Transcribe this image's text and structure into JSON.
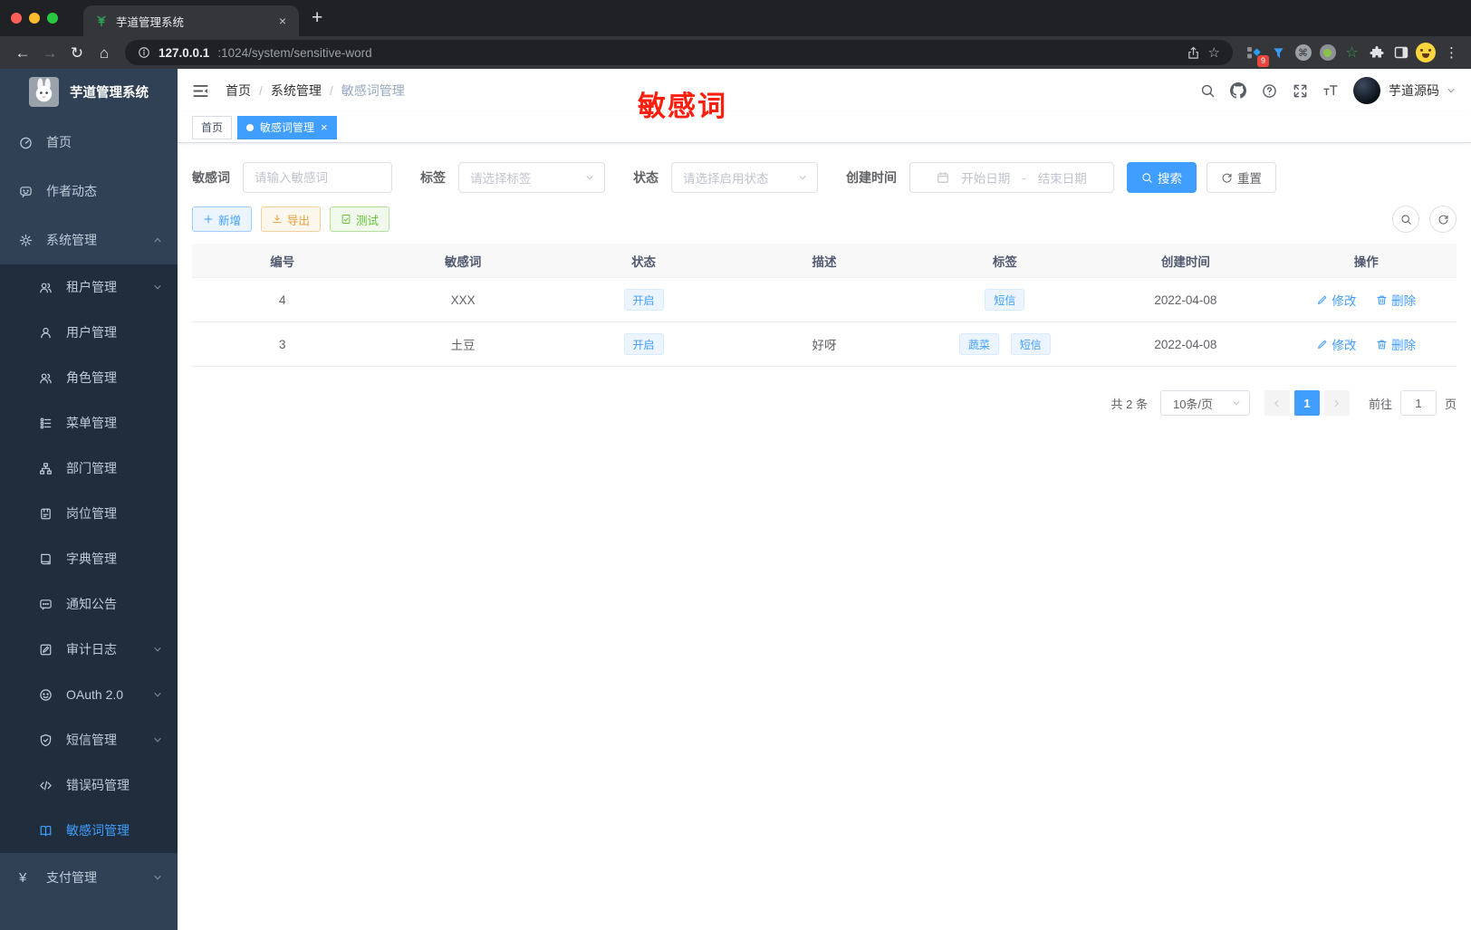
{
  "browser": {
    "tab_title": "芋道管理系统",
    "url_host": "127.0.0.1",
    "url_rest": ":1024/system/sensitive-word",
    "ext_badge": "9"
  },
  "icons": {
    "close": "×",
    "plus": "+",
    "kebab": "⋮",
    "star_outline": "☆",
    "back": "←",
    "forward": "→",
    "reload": "↻",
    "home": "⌂",
    "command": "⌘",
    "yen": "¥"
  },
  "sidebar": {
    "title": "芋道管理系统",
    "items": [
      {
        "label": "首页"
      },
      {
        "label": "作者动态"
      },
      {
        "label": "系统管理"
      },
      {
        "label": "租户管理"
      },
      {
        "label": "用户管理"
      },
      {
        "label": "角色管理"
      },
      {
        "label": "菜单管理"
      },
      {
        "label": "部门管理"
      },
      {
        "label": "岗位管理"
      },
      {
        "label": "字典管理"
      },
      {
        "label": "通知公告"
      },
      {
        "label": "审计日志"
      },
      {
        "label": "OAuth 2.0"
      },
      {
        "label": "短信管理"
      },
      {
        "label": "错误码管理"
      },
      {
        "label": "敏感词管理"
      },
      {
        "label": "支付管理"
      }
    ]
  },
  "navbar": {
    "breadcrumb": [
      {
        "label": "首页"
      },
      {
        "label": "系统管理"
      },
      {
        "label": "敏感词管理"
      }
    ],
    "sep": "/",
    "username": "芋道源码"
  },
  "tagsbar": {
    "tabs": [
      {
        "label": "首页"
      },
      {
        "label": "敏感词管理"
      }
    ]
  },
  "annotation": {
    "text": "敏感词",
    "color": "#ff1f0f"
  },
  "filters": {
    "keyword": {
      "label": "敏感词",
      "placeholder": "请输入敏感词"
    },
    "tag": {
      "label": "标签",
      "placeholder": "请选择标签"
    },
    "status": {
      "label": "状态",
      "placeholder": "请选择启用状态"
    },
    "created": {
      "label": "创建时间",
      "start_placeholder": "开始日期",
      "separator": "-",
      "end_placeholder": "结束日期"
    },
    "search_label": "搜索",
    "reset_label": "重置"
  },
  "toolbar": {
    "add": "新增",
    "export": "导出",
    "test": "测试"
  },
  "table": {
    "columns": [
      "编号",
      "敏感词",
      "状态",
      "描述",
      "标签",
      "创建时间",
      "操作"
    ],
    "actions": {
      "edit": "修改",
      "delete": "删除"
    },
    "rows": [
      {
        "id": "4",
        "word": "XXX",
        "status": "开启",
        "description": "",
        "tags": [
          "短信"
        ],
        "created": "2022-04-08"
      },
      {
        "id": "3",
        "word": "土豆",
        "status": "开启",
        "description": "好呀",
        "tags": [
          "蔬菜",
          "短信"
        ],
        "created": "2022-04-08"
      }
    ]
  },
  "pagination": {
    "total": "共 2 条",
    "page_size": "10条/页",
    "page": "1",
    "goto_label": "前往",
    "goto_value": "1",
    "unit": "页"
  },
  "colors": {
    "accent": "#409eff",
    "sidebar_bg": "#304156",
    "submenu_bg": "#1f2d3d",
    "tab_active": "#409eff"
  }
}
